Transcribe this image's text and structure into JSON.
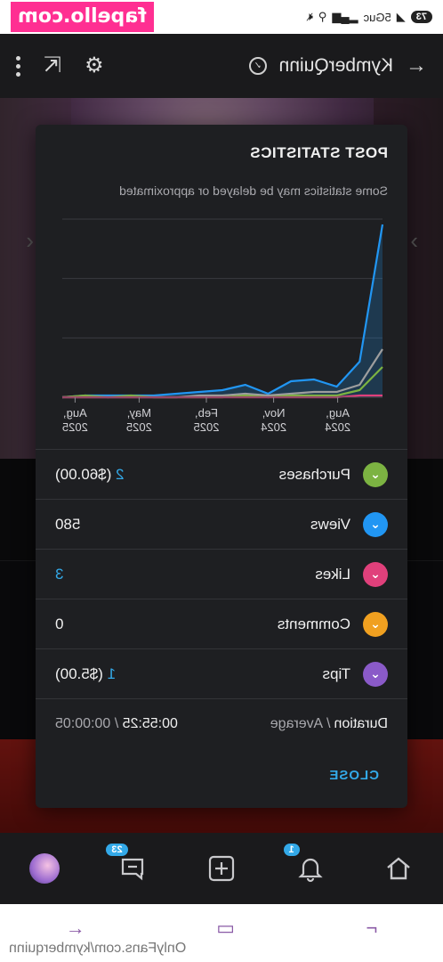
{
  "statusbar": {
    "watermark": "fapello.com",
    "battery": "73",
    "network": "5G",
    "network_suffix": "uc"
  },
  "appbar": {
    "title": "KymberQuinn"
  },
  "modal": {
    "title": "POST STATISTICS",
    "subtitle": "Some statistics may be delayed or approximated",
    "close_label": "CLOSE",
    "rows": [
      {
        "key": "purchases",
        "label": "Purchases",
        "value": "2",
        "extra": "($60.00)",
        "color": "#7cb342"
      },
      {
        "key": "views",
        "label": "Views",
        "value": "580",
        "extra": "",
        "color": "#2196f3"
      },
      {
        "key": "likes",
        "label": "Likes",
        "value": "3",
        "extra": "",
        "color": "#e0407b"
      },
      {
        "key": "comments",
        "label": "Comments",
        "value": "0",
        "extra": "",
        "color": "#f0a020"
      },
      {
        "key": "tips",
        "label": "Tips",
        "value": "1",
        "extra": "($5.00)",
        "color": "#8a5ac8"
      }
    ],
    "duration": {
      "label": "Duration",
      "sep": "/",
      "avg_label": "Average",
      "value": "00:55:25",
      "avg_value": "00:00:05"
    }
  },
  "chart_data": {
    "type": "line",
    "x_ticks": [
      {
        "line1": "Aug,",
        "line2": "2024"
      },
      {
        "line1": "Nov,",
        "line2": "2024"
      },
      {
        "line1": "Feb,",
        "line2": "2025"
      },
      {
        "line1": "May,",
        "line2": "2025"
      },
      {
        "line1": "Aug,",
        "line2": "2025"
      }
    ],
    "x_tick_positions": [
      0.14,
      0.34,
      0.55,
      0.76,
      0.96
    ],
    "grid": true,
    "series": [
      {
        "name": "Views",
        "color": "#2196f3",
        "fill": true,
        "values": [
          0.97,
          0.2,
          0.06,
          0.1,
          0.09,
          0.02,
          0.07,
          0.04,
          0.03,
          0.02,
          0.01,
          0.01,
          0.01,
          0.01,
          0.0
        ]
      },
      {
        "name": "Comments",
        "color": "#9e9e9e",
        "fill": false,
        "values": [
          0.27,
          0.07,
          0.03,
          0.03,
          0.02,
          0.01,
          0.02,
          0.01,
          0.01,
          0.0,
          0.0,
          0.0,
          0.0,
          0.0,
          0.0
        ]
      },
      {
        "name": "Purchases",
        "color": "#7cb342",
        "fill": false,
        "values": [
          0.17,
          0.04,
          0.01,
          0.01,
          0.01,
          0.0,
          0.01,
          0.0,
          0.0,
          0.0,
          0.0,
          0.01,
          0.0,
          0.01,
          0.0
        ]
      },
      {
        "name": "Likes",
        "color": "#e0407b",
        "fill": false,
        "values": [
          0.01,
          0.01,
          0.0,
          0.0,
          0.0,
          0.0,
          0.0,
          0.0,
          0.0,
          0.0,
          0.0,
          0.0,
          0.0,
          0.0,
          0.0
        ]
      }
    ],
    "ylim": [
      0,
      1
    ]
  },
  "bottomnav": {
    "messages_badge": "23",
    "notifications_badge": "1"
  },
  "browser": {
    "url": "OnlyFans.com/kymberquinn"
  }
}
